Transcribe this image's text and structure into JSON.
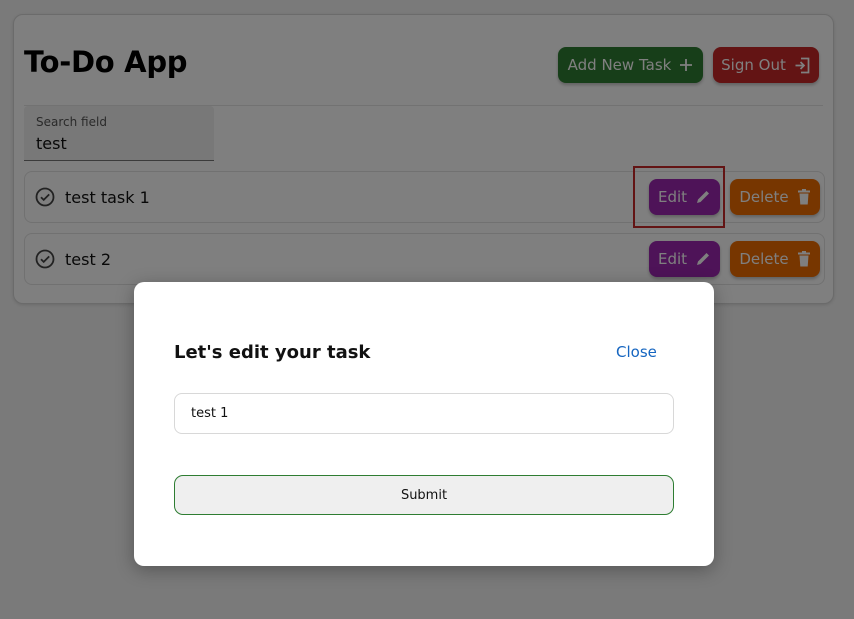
{
  "app": {
    "title": "To-Do App",
    "add_task_label": "Add New Task",
    "sign_out_label": "Sign Out"
  },
  "search": {
    "label": "Search field",
    "value": "test"
  },
  "tasks": [
    {
      "label": "test task 1",
      "edit_label": "Edit",
      "delete_label": "Delete"
    },
    {
      "label": "test 2",
      "edit_label": "Edit",
      "delete_label": "Delete"
    }
  ],
  "modal": {
    "title": "Let's edit your task",
    "close_label": "Close",
    "input_value": "test 1",
    "submit_label": "Submit"
  },
  "icons": {
    "add": "plus-icon",
    "sign_out": "sign-out-icon",
    "task_status": "check-circle-icon",
    "edit": "pencil-icon",
    "delete": "trash-icon"
  },
  "colors": {
    "add_button": "#2e7d32",
    "sign_out_button": "#c62828",
    "edit_button": "#9c27b0",
    "delete_button": "#ef6c00",
    "close_link": "#1565c0",
    "submit_border": "#2e7d32",
    "highlight": "#c62828"
  }
}
